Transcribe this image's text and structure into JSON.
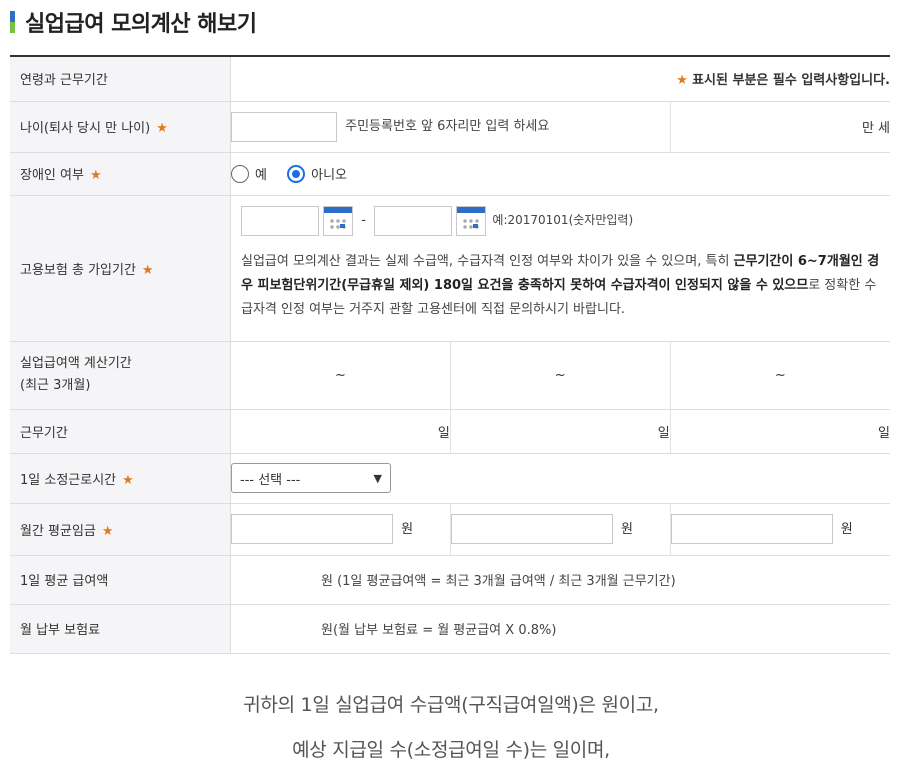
{
  "page_title": "실업급여 모의계산 해보기",
  "rows": {
    "age_work_period": {
      "label": "연령과 근무기간",
      "notice_star": "★",
      "notice": "표시된 부분은 필수 입력사항입니다."
    },
    "age": {
      "label": "나이(퇴사 당시 만 나이)",
      "hint": "주민등록번호 앞 6자리만 입력 하세요",
      "unit": "만 세"
    },
    "disabled": {
      "label": "장애인 여부",
      "options": [
        "예",
        "아니오"
      ],
      "selected": "아니오"
    },
    "insurance_period": {
      "label": "고용보험 총 가입기간",
      "separator": "-",
      "example": "예:20170101(숫자만입력)",
      "notice_1": "실업급여 모의계산 결과는 실제 수급액, 수급자격 인정 여부와 차이가 있을 수 있으며, 특히 ",
      "notice_bold": "근무기간이 6~7개월인 경우 피보험단위기간(무급휴일 제외) 180일 요건을 충족하지 못하여 수급자격이 인정되지 않을 수 있으므",
      "notice_2": "로 정확한 수급자격 인정 여부는 거주지 관할 고용센터에 직접 문의하시기 바랍니다."
    },
    "calc_period": {
      "label_1": "실업급여액 계산기간",
      "label_2": "(최근 3개월)",
      "tilde": "~"
    },
    "work_days": {
      "label": "근무기간",
      "unit": "일"
    },
    "daily_hours": {
      "label": "1일 소정근로시간",
      "select_value": "--- 선택 ---"
    },
    "monthly_wage": {
      "label": "월간 평균임금",
      "unit": "원"
    },
    "daily_avg": {
      "label": "1일 평균 급여액",
      "text": "원 (1일 평균급여액 = 최근 3개월 급여액 / 최근 3개월 근무기간)"
    },
    "monthly_premium": {
      "label": "월 납부 보험료",
      "text": "원(월 납부 보험료 = 월 평균급여 X 0.8%)"
    }
  },
  "required_mark": "★",
  "result_line_1": "귀하의 1일 실업급여 수급액(구직급여일액)은 원이고,",
  "result_line_2": "예상 지급일 수(소정급여일 수)는 일이며,",
  "colors": {
    "accent_blue": "#2f6ec6",
    "accent_green": "#7ac143",
    "required": "#e07a1f",
    "radio_on": "#1a6fe0"
  }
}
